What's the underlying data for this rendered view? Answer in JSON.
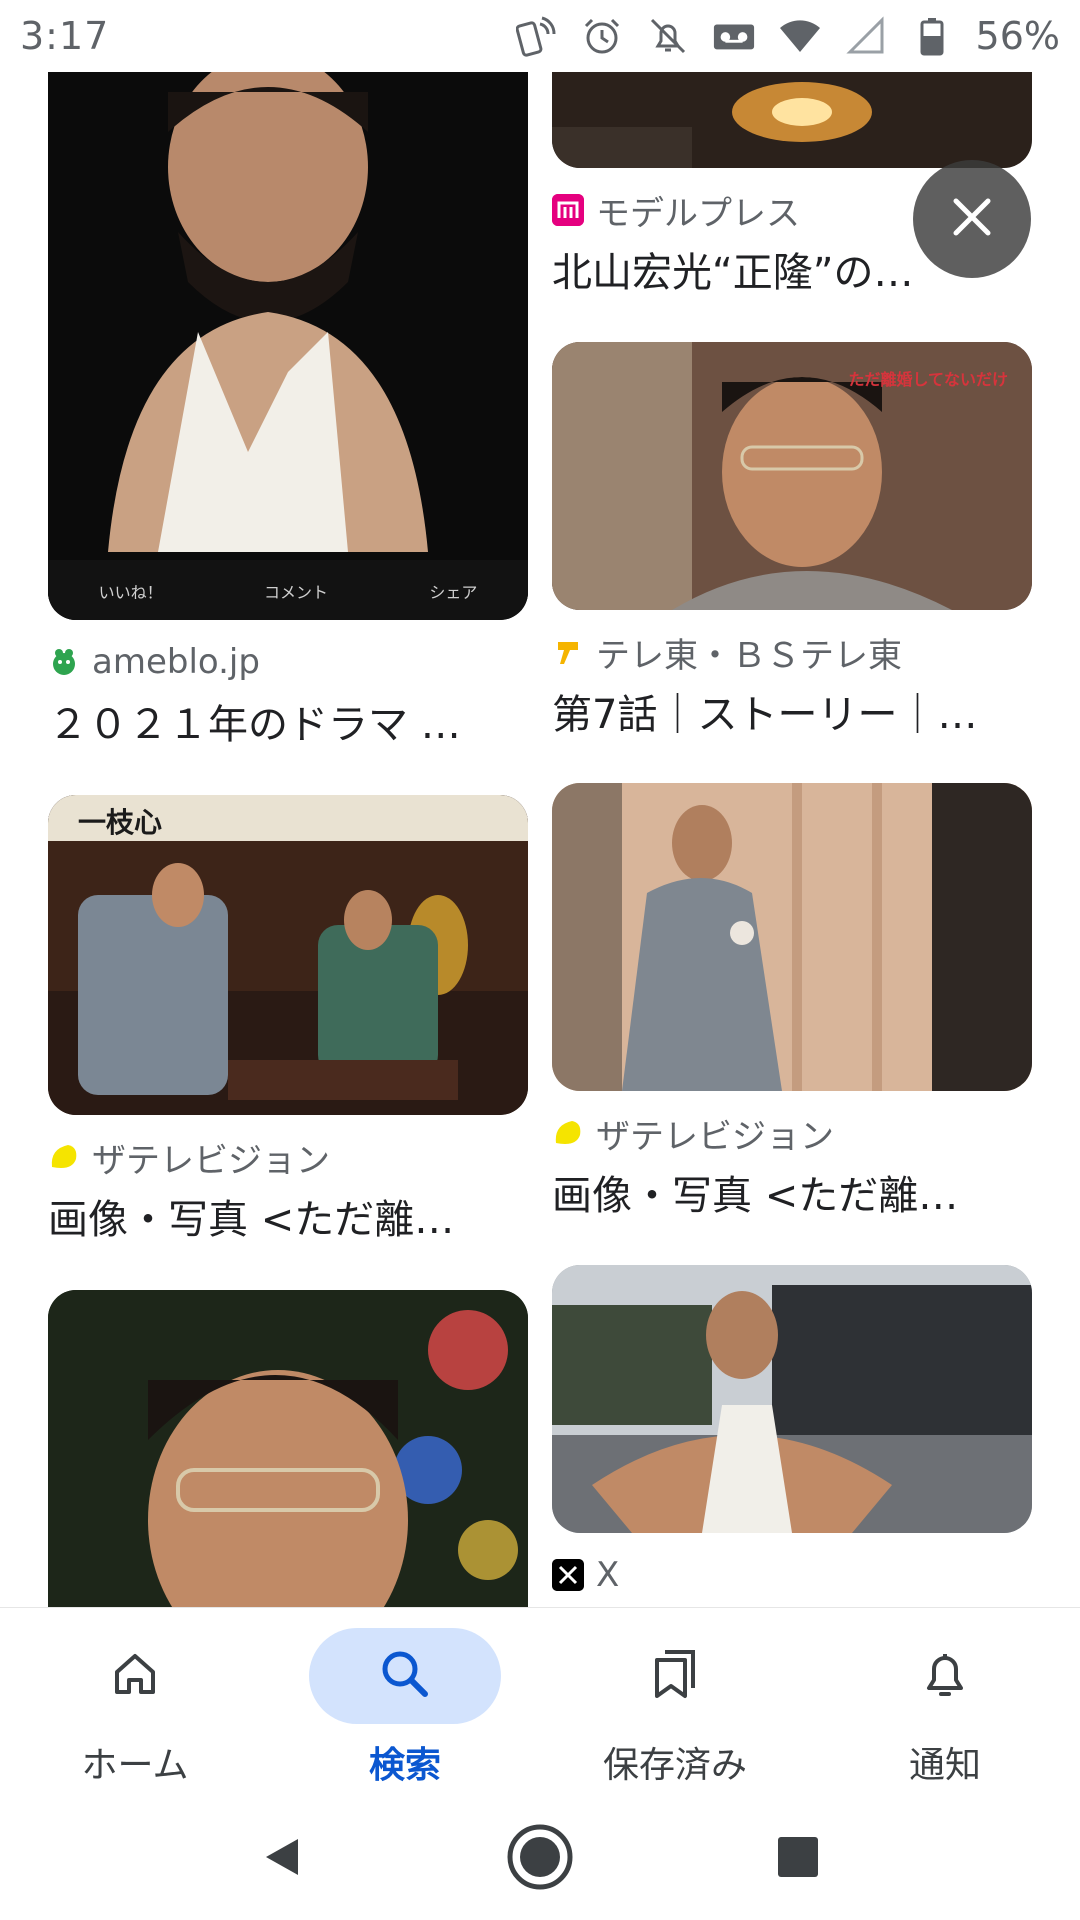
{
  "status_bar": {
    "time": "3:17",
    "battery_percent": "56%",
    "icons": [
      "nfc-icon",
      "alarm-icon",
      "notifications-off-icon",
      "voicemail-icon",
      "wifi-icon",
      "signal-icon",
      "battery-icon"
    ]
  },
  "colors": {
    "accent": "#0b57d0",
    "active_pill": "#d3e3fd",
    "source_text": "#5f6368",
    "title_text": "#202124",
    "modelpress_brand": "#e5007f",
    "ameblo_brand": "#2ea44f",
    "thetv_brand": "#f5e400",
    "tvtokyo_brand": "#f5b400"
  },
  "results": [
    {
      "source": "ameblo.jp",
      "favicon": "ameblo-icon",
      "title": "２０２１年のドラマ …"
    },
    {
      "source": "モデルプレス",
      "favicon": "modelpress-icon",
      "title": "北山宏光“正隆”の…"
    },
    {
      "source": "テレ東・ＢＳテレ東",
      "favicon": "tvtokyo-icon",
      "title": "第7話｜ストーリー｜…",
      "overlay_text": "ただ離婚してないだけ"
    },
    {
      "source": "ザテレビジョン",
      "favicon": "thetv-icon",
      "title": "画像・写真 <ただ離…",
      "overlay_text": "一枝心"
    },
    {
      "source": "ザテレビジョン",
      "favicon": "thetv-icon",
      "title": "画像・写真 <ただ離…"
    },
    {
      "source": "X",
      "favicon": "x-icon",
      "title": ""
    }
  ],
  "image_actions": {
    "like": "いいね！",
    "comment": "コメント",
    "share": "シェア"
  },
  "close_button": "close-icon",
  "bottom_nav": [
    {
      "label": "ホーム",
      "icon": "home-icon",
      "active": false
    },
    {
      "label": "検索",
      "icon": "search-icon",
      "active": true
    },
    {
      "label": "保存済み",
      "icon": "collections-icon",
      "active": false
    },
    {
      "label": "通知",
      "icon": "bell-icon",
      "active": false
    }
  ],
  "system_nav": [
    "back-icon",
    "home-circle-icon",
    "recents-icon"
  ]
}
